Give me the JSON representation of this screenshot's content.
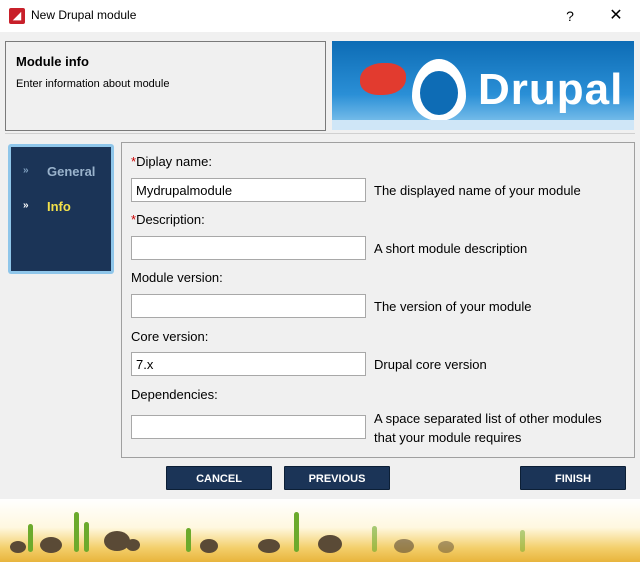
{
  "window": {
    "title": "New Drupal module",
    "help": "?",
    "close": "✕"
  },
  "header": {
    "title": "Module info",
    "subtitle": "Enter information about module",
    "banner_text": "Drupal"
  },
  "nav": {
    "items": [
      {
        "label": "General",
        "state": "inactive"
      },
      {
        "label": "Info",
        "state": "active"
      }
    ],
    "arrow": "»"
  },
  "form": {
    "display_name": {
      "required": "*",
      "label": "Diplay name:",
      "value": "Mydrupalmodule",
      "hint": "The displayed name of your module"
    },
    "description": {
      "required": "*",
      "label": "Description:",
      "value": "",
      "hint": "A short module description"
    },
    "module_version": {
      "label": "Module version:",
      "value": "",
      "hint": "The version of your module"
    },
    "core_version": {
      "label": "Core version:",
      "value": "7.x",
      "hint": "Drupal core version"
    },
    "dependencies": {
      "label": "Dependencies:",
      "value": "",
      "hint_line1": "A space separated list of other modules",
      "hint_line2": "that your module requires"
    }
  },
  "buttons": {
    "cancel": "CANCEL",
    "previous": "PREVIOUS",
    "finish": "FINISH"
  },
  "colors": {
    "nav_bg": "#1b3457",
    "active_nav": "#f2e04a",
    "required": "#cc0000",
    "button_bg": "#1b3457"
  }
}
